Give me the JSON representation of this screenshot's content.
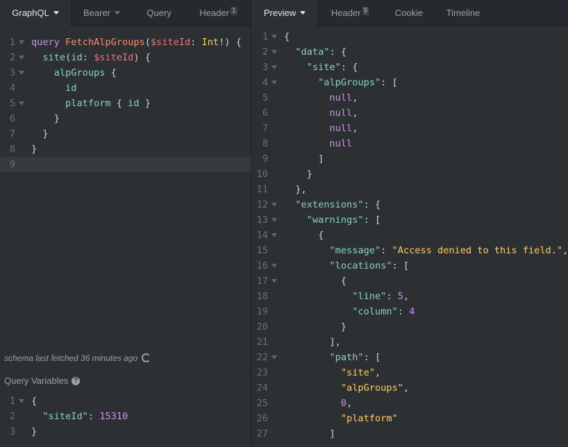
{
  "left_tabs": [
    {
      "label": "GraphQL",
      "active": true,
      "dropdown": true
    },
    {
      "label": "Bearer",
      "active": false,
      "dropdown": true
    },
    {
      "label": "Query",
      "active": false,
      "dropdown": false
    },
    {
      "label": "Header",
      "active": false,
      "badge": "1"
    }
  ],
  "right_tabs": [
    {
      "label": "Preview",
      "active": true,
      "dropdown": true
    },
    {
      "label": "Header",
      "active": false,
      "badge": "9"
    },
    {
      "label": "Cookie",
      "active": false
    },
    {
      "label": "Timeline",
      "active": false
    }
  ],
  "query_editor": {
    "lines": [
      {
        "n": "1",
        "fold": true,
        "indent": "",
        "parts": [
          [
            "kw",
            "query"
          ],
          [
            "pn",
            " "
          ],
          [
            "fn",
            "FetchAlpGroups"
          ],
          [
            "pn",
            "("
          ],
          [
            "var",
            "$siteId"
          ],
          [
            "pn",
            ": "
          ],
          [
            "ty",
            "Int"
          ],
          [
            "pn",
            "!) {"
          ]
        ]
      },
      {
        "n": "2",
        "fold": true,
        "indent": "  ",
        "parts": [
          [
            "fld",
            "site"
          ],
          [
            "pn",
            "("
          ],
          [
            "fld",
            "id"
          ],
          [
            "pn",
            ": "
          ],
          [
            "var",
            "$siteId"
          ],
          [
            "pn",
            ") {"
          ]
        ]
      },
      {
        "n": "3",
        "fold": true,
        "indent": "    ",
        "parts": [
          [
            "fld",
            "alpGroups"
          ],
          [
            "pn",
            " {"
          ]
        ]
      },
      {
        "n": "4",
        "fold": false,
        "indent": "      ",
        "parts": [
          [
            "fld",
            "id"
          ]
        ]
      },
      {
        "n": "5",
        "fold": true,
        "indent": "      ",
        "parts": [
          [
            "fld",
            "platform"
          ],
          [
            "pn",
            " { "
          ],
          [
            "fld",
            "id"
          ],
          [
            "pn",
            " }"
          ]
        ]
      },
      {
        "n": "6",
        "fold": false,
        "indent": "    ",
        "parts": [
          [
            "pn",
            "}"
          ]
        ]
      },
      {
        "n": "7",
        "fold": false,
        "indent": "  ",
        "parts": [
          [
            "pn",
            "}"
          ]
        ]
      },
      {
        "n": "8",
        "fold": false,
        "indent": "",
        "parts": [
          [
            "pn",
            "}"
          ]
        ]
      },
      {
        "n": "9",
        "fold": false,
        "indent": "",
        "parts": []
      }
    ],
    "active_line": "9"
  },
  "schema_status": "schema last fetched 36 minutes ago",
  "query_variables": {
    "label": "Query Variables",
    "lines": [
      {
        "n": "1",
        "fold": true,
        "indent": "",
        "parts": [
          [
            "pn",
            "{"
          ]
        ]
      },
      {
        "n": "2",
        "fold": false,
        "indent": "  ",
        "parts": [
          [
            "key",
            "\"siteId\""
          ],
          [
            "pn",
            ": "
          ],
          [
            "num",
            "15310"
          ]
        ]
      },
      {
        "n": "3",
        "fold": false,
        "indent": "",
        "parts": [
          [
            "pn",
            "}"
          ]
        ]
      }
    ]
  },
  "response": {
    "lines": [
      {
        "n": "1",
        "fold": true,
        "indent": "",
        "parts": [
          [
            "pn",
            "{"
          ]
        ]
      },
      {
        "n": "2",
        "fold": true,
        "indent": "  ",
        "parts": [
          [
            "key",
            "\"data\""
          ],
          [
            "pn",
            ": {"
          ]
        ]
      },
      {
        "n": "3",
        "fold": true,
        "indent": "    ",
        "parts": [
          [
            "key",
            "\"site\""
          ],
          [
            "pn",
            ": {"
          ]
        ]
      },
      {
        "n": "4",
        "fold": true,
        "indent": "      ",
        "parts": [
          [
            "key",
            "\"alpGroups\""
          ],
          [
            "pn",
            ": ["
          ]
        ]
      },
      {
        "n": "5",
        "fold": false,
        "indent": "        ",
        "parts": [
          [
            "nul",
            "null"
          ],
          [
            "pn",
            ","
          ]
        ]
      },
      {
        "n": "6",
        "fold": false,
        "indent": "        ",
        "parts": [
          [
            "nul",
            "null"
          ],
          [
            "pn",
            ","
          ]
        ]
      },
      {
        "n": "7",
        "fold": false,
        "indent": "        ",
        "parts": [
          [
            "nul",
            "null"
          ],
          [
            "pn",
            ","
          ]
        ]
      },
      {
        "n": "8",
        "fold": false,
        "indent": "        ",
        "parts": [
          [
            "nul",
            "null"
          ]
        ]
      },
      {
        "n": "9",
        "fold": false,
        "indent": "      ",
        "parts": [
          [
            "pn",
            "]"
          ]
        ]
      },
      {
        "n": "10",
        "fold": false,
        "indent": "    ",
        "parts": [
          [
            "pn",
            "}"
          ]
        ]
      },
      {
        "n": "11",
        "fold": false,
        "indent": "  ",
        "parts": [
          [
            "pn",
            "},"
          ]
        ]
      },
      {
        "n": "12",
        "fold": true,
        "indent": "  ",
        "parts": [
          [
            "key",
            "\"extensions\""
          ],
          [
            "pn",
            ": {"
          ]
        ]
      },
      {
        "n": "13",
        "fold": true,
        "indent": "    ",
        "parts": [
          [
            "key",
            "\"warnings\""
          ],
          [
            "pn",
            ": ["
          ]
        ]
      },
      {
        "n": "14",
        "fold": true,
        "indent": "      ",
        "parts": [
          [
            "pn",
            "{"
          ]
        ]
      },
      {
        "n": "15",
        "fold": false,
        "indent": "        ",
        "parts": [
          [
            "key",
            "\"message\""
          ],
          [
            "pn",
            ": "
          ],
          [
            "str",
            "\"Access denied to this field.\""
          ],
          [
            "pn",
            ","
          ]
        ]
      },
      {
        "n": "16",
        "fold": true,
        "indent": "        ",
        "parts": [
          [
            "key",
            "\"locations\""
          ],
          [
            "pn",
            ": ["
          ]
        ]
      },
      {
        "n": "17",
        "fold": true,
        "indent": "          ",
        "parts": [
          [
            "pn",
            "{"
          ]
        ]
      },
      {
        "n": "18",
        "fold": false,
        "indent": "            ",
        "parts": [
          [
            "key",
            "\"line\""
          ],
          [
            "pn",
            ": "
          ],
          [
            "num",
            "5"
          ],
          [
            "pn",
            ","
          ]
        ]
      },
      {
        "n": "19",
        "fold": false,
        "indent": "            ",
        "parts": [
          [
            "key",
            "\"column\""
          ],
          [
            "pn",
            ": "
          ],
          [
            "num",
            "4"
          ]
        ]
      },
      {
        "n": "20",
        "fold": false,
        "indent": "          ",
        "parts": [
          [
            "pn",
            "}"
          ]
        ]
      },
      {
        "n": "21",
        "fold": false,
        "indent": "        ",
        "parts": [
          [
            "pn",
            "],"
          ]
        ]
      },
      {
        "n": "22",
        "fold": true,
        "indent": "        ",
        "parts": [
          [
            "key",
            "\"path\""
          ],
          [
            "pn",
            ": ["
          ]
        ]
      },
      {
        "n": "23",
        "fold": false,
        "indent": "          ",
        "parts": [
          [
            "str",
            "\"site\""
          ],
          [
            "pn",
            ","
          ]
        ]
      },
      {
        "n": "24",
        "fold": false,
        "indent": "          ",
        "parts": [
          [
            "str",
            "\"alpGroups\""
          ],
          [
            "pn",
            ","
          ]
        ]
      },
      {
        "n": "25",
        "fold": false,
        "indent": "          ",
        "parts": [
          [
            "num",
            "0"
          ],
          [
            "pn",
            ","
          ]
        ]
      },
      {
        "n": "26",
        "fold": false,
        "indent": "          ",
        "parts": [
          [
            "str",
            "\"platform\""
          ]
        ]
      },
      {
        "n": "27",
        "fold": false,
        "indent": "        ",
        "parts": [
          [
            "pn",
            "]"
          ]
        ]
      }
    ]
  },
  "colors": {
    "background": "#2d3033",
    "tabbar": "#262a2e",
    "keyword": "#c792ea",
    "string": "#ffcb6b",
    "field": "#8ad0c4",
    "variable": "#f07178"
  }
}
